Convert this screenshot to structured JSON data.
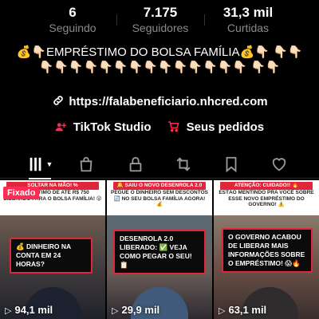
{
  "stats": [
    {
      "value": "6",
      "label": "Seguindo"
    },
    {
      "value": "7.175",
      "label": "Seguidores"
    },
    {
      "value": "31,3 mil",
      "label": "Curtidas"
    }
  ],
  "bio": "💰👇🏻EMPRÉSTIMO DO BOLSA FAMÍLIA💰👇🏻 👇🏻👇🏻👇🏻👇🏻👇🏻👇🏻👇🏻👇🏻👇🏻👇🏻👇🏻👇🏻👇🏻👇🏻👇🏻👇🏻 👇🏻👇🏻",
  "link": {
    "icon": "link-icon",
    "text": "https://falabeneficiario.nhcred.com"
  },
  "shop": [
    {
      "icon": "person-plus-icon",
      "label": "TikTok Studio"
    },
    {
      "icon": "cart-icon",
      "label": "Seus pedidos"
    }
  ],
  "tabs": [
    {
      "icon": "grid-icon",
      "active": true
    },
    {
      "icon": "shopping-bag-icon",
      "active": false
    },
    {
      "icon": "lock-icon",
      "active": false
    },
    {
      "icon": "repost-icon",
      "active": false
    },
    {
      "icon": "bookmark-icon",
      "active": false
    },
    {
      "icon": "heart-icon",
      "active": false
    }
  ],
  "videos": [
    {
      "pinned_label": "Fixado",
      "banner": "SOLTAR NA MÃO! %",
      "top_text": "EMPRÉSTIMO DE ATÉ R$ 750 LIBERADO PARA O BOLSA FAMÍLIA! 😲",
      "caption": "💰 DINHEIRO NA CONTA EM 24 HORAS?",
      "views": "94,1 mil"
    },
    {
      "banner": "🔔 SAIU O NOVO DESENROLA 2.0",
      "top_text": "PEGUE O DINHEIRO SEM DESCONTOS 🔄 NO SEU BOLSA FAMÍLIA AGORA! 💰",
      "caption": "DESENROLA 2.0 LIBERADO: ✅ VEJA COMO PEGAR O SEU! 📋",
      "views": "29,9 mil"
    },
    {
      "banner": "ATENÇÃO: CUIDADO!! 🔥",
      "top_text": "ESTÃO MENTINDO PRA VOCÊ SOBRE ESSE NOVO EMPRÉSTIMO DO GOVERNO! ⚠️",
      "caption": "O GOVERNO ACABOU DE LIBERAR MAIS INFORMAÇÕES SOBRE O EMPRÉSTIMO! 😱🔥",
      "views": "63,1 mil"
    }
  ],
  "colors": {
    "accent": "#fe2c55",
    "banner_red": "#e0263a",
    "muted": "#8a8a8a"
  }
}
